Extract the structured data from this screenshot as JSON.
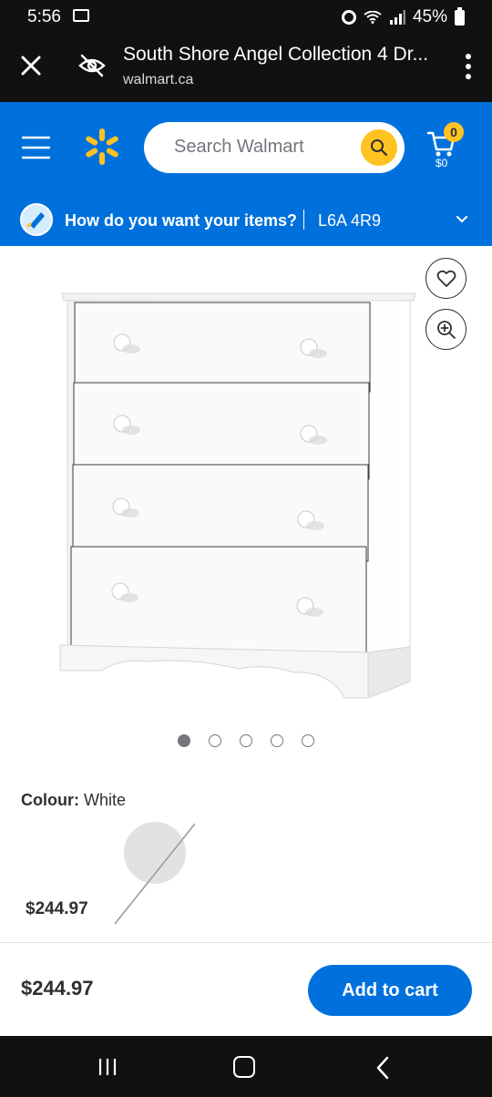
{
  "status_bar": {
    "time": "5:56",
    "battery": "45%"
  },
  "browser": {
    "title": "South Shore Angel Collection 4 Dr...",
    "domain": "walmart.ca"
  },
  "header": {
    "search_placeholder": "Search Walmart",
    "cart_count": "0",
    "cart_total": "$0",
    "delivery_question": "How do you want your items?",
    "postal_code": "L6A 4R9",
    "brand_color": "#0071dc",
    "accent_color": "#ffc220"
  },
  "gallery": {
    "image_count": 5,
    "active_index": 0
  },
  "colour": {
    "label": "Colour:",
    "value": "White",
    "swatch_price": "$244.97"
  },
  "purchase": {
    "price": "$244.97",
    "add_to_cart_label": "Add to cart"
  }
}
